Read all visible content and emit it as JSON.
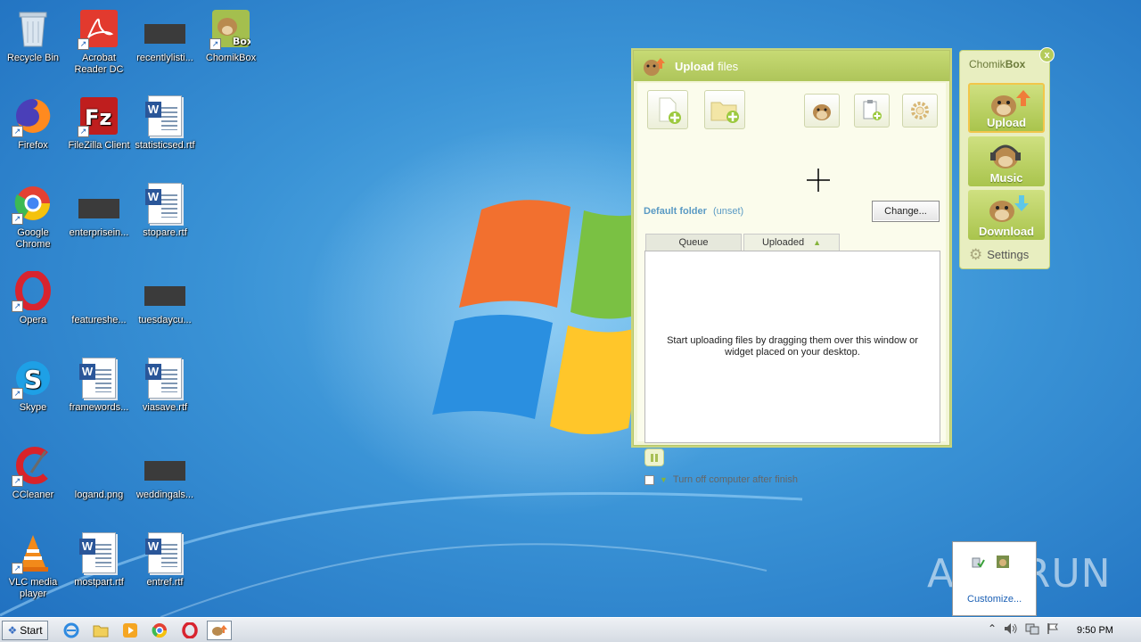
{
  "desktop": {
    "icons": [
      {
        "label": "Recycle Bin",
        "icon": "recycle-bin-icon"
      },
      {
        "label": "Acrobat Reader DC",
        "icon": "acrobat-icon"
      },
      {
        "label": "recentlylisti...",
        "icon": "dark-file-icon"
      },
      {
        "label": "ChomikBox",
        "icon": "chomikbox-icon"
      },
      {
        "label": "Firefox",
        "icon": "firefox-icon"
      },
      {
        "label": "FileZilla Client",
        "icon": "filezilla-icon"
      },
      {
        "label": "statisticsed.rtf",
        "icon": "word-doc-icon"
      },
      {
        "label": "Google Chrome",
        "icon": "chrome-icon"
      },
      {
        "label": "enterprisein...",
        "icon": "dark-file-icon"
      },
      {
        "label": "stopare.rtf",
        "icon": "word-doc-icon"
      },
      {
        "label": "Opera",
        "icon": "opera-icon"
      },
      {
        "label": "featureshe...",
        "icon": "blank-file-icon"
      },
      {
        "label": "tuesdaycu...",
        "icon": "dark-file-icon"
      },
      {
        "label": "Skype",
        "icon": "skype-icon"
      },
      {
        "label": "framewords...",
        "icon": "word-doc-icon"
      },
      {
        "label": "viasave.rtf",
        "icon": "word-doc-icon"
      },
      {
        "label": "CCleaner",
        "icon": "ccleaner-icon"
      },
      {
        "label": "logand.png",
        "icon": "blank-file-icon"
      },
      {
        "label": "weddingals...",
        "icon": "dark-file-icon"
      },
      {
        "label": "VLC media player",
        "icon": "vlc-icon"
      },
      {
        "label": "mostpart.rtf",
        "icon": "word-doc-icon"
      },
      {
        "label": "entref.rtf",
        "icon": "word-doc-icon"
      }
    ]
  },
  "upload_window": {
    "title_strong": "Upload",
    "title_rest": "files",
    "default_folder_label": "Default folder",
    "default_folder_value": "(unset)",
    "change_button": "Change...",
    "tabs": {
      "queue": "Queue",
      "uploaded": "Uploaded"
    },
    "drop_hint": "Start uploading files by dragging them over this window or widget placed on your desktop.",
    "turn_off_label": "Turn off computer after finish"
  },
  "widget": {
    "title_light": "Chomik",
    "title_bold": "Box",
    "close": "x",
    "buttons": {
      "upload": "Upload",
      "music": "Music",
      "download": "Download"
    },
    "settings": "Settings"
  },
  "tray_popup": {
    "customize": "Customize..."
  },
  "watermark": "ANY RUN",
  "taskbar": {
    "start": "Start",
    "clock": "9:50 PM"
  },
  "colors": {
    "window_green": "#aec55a",
    "window_bg": "#f2f5d6",
    "accent_blue": "#5a9ac4"
  }
}
